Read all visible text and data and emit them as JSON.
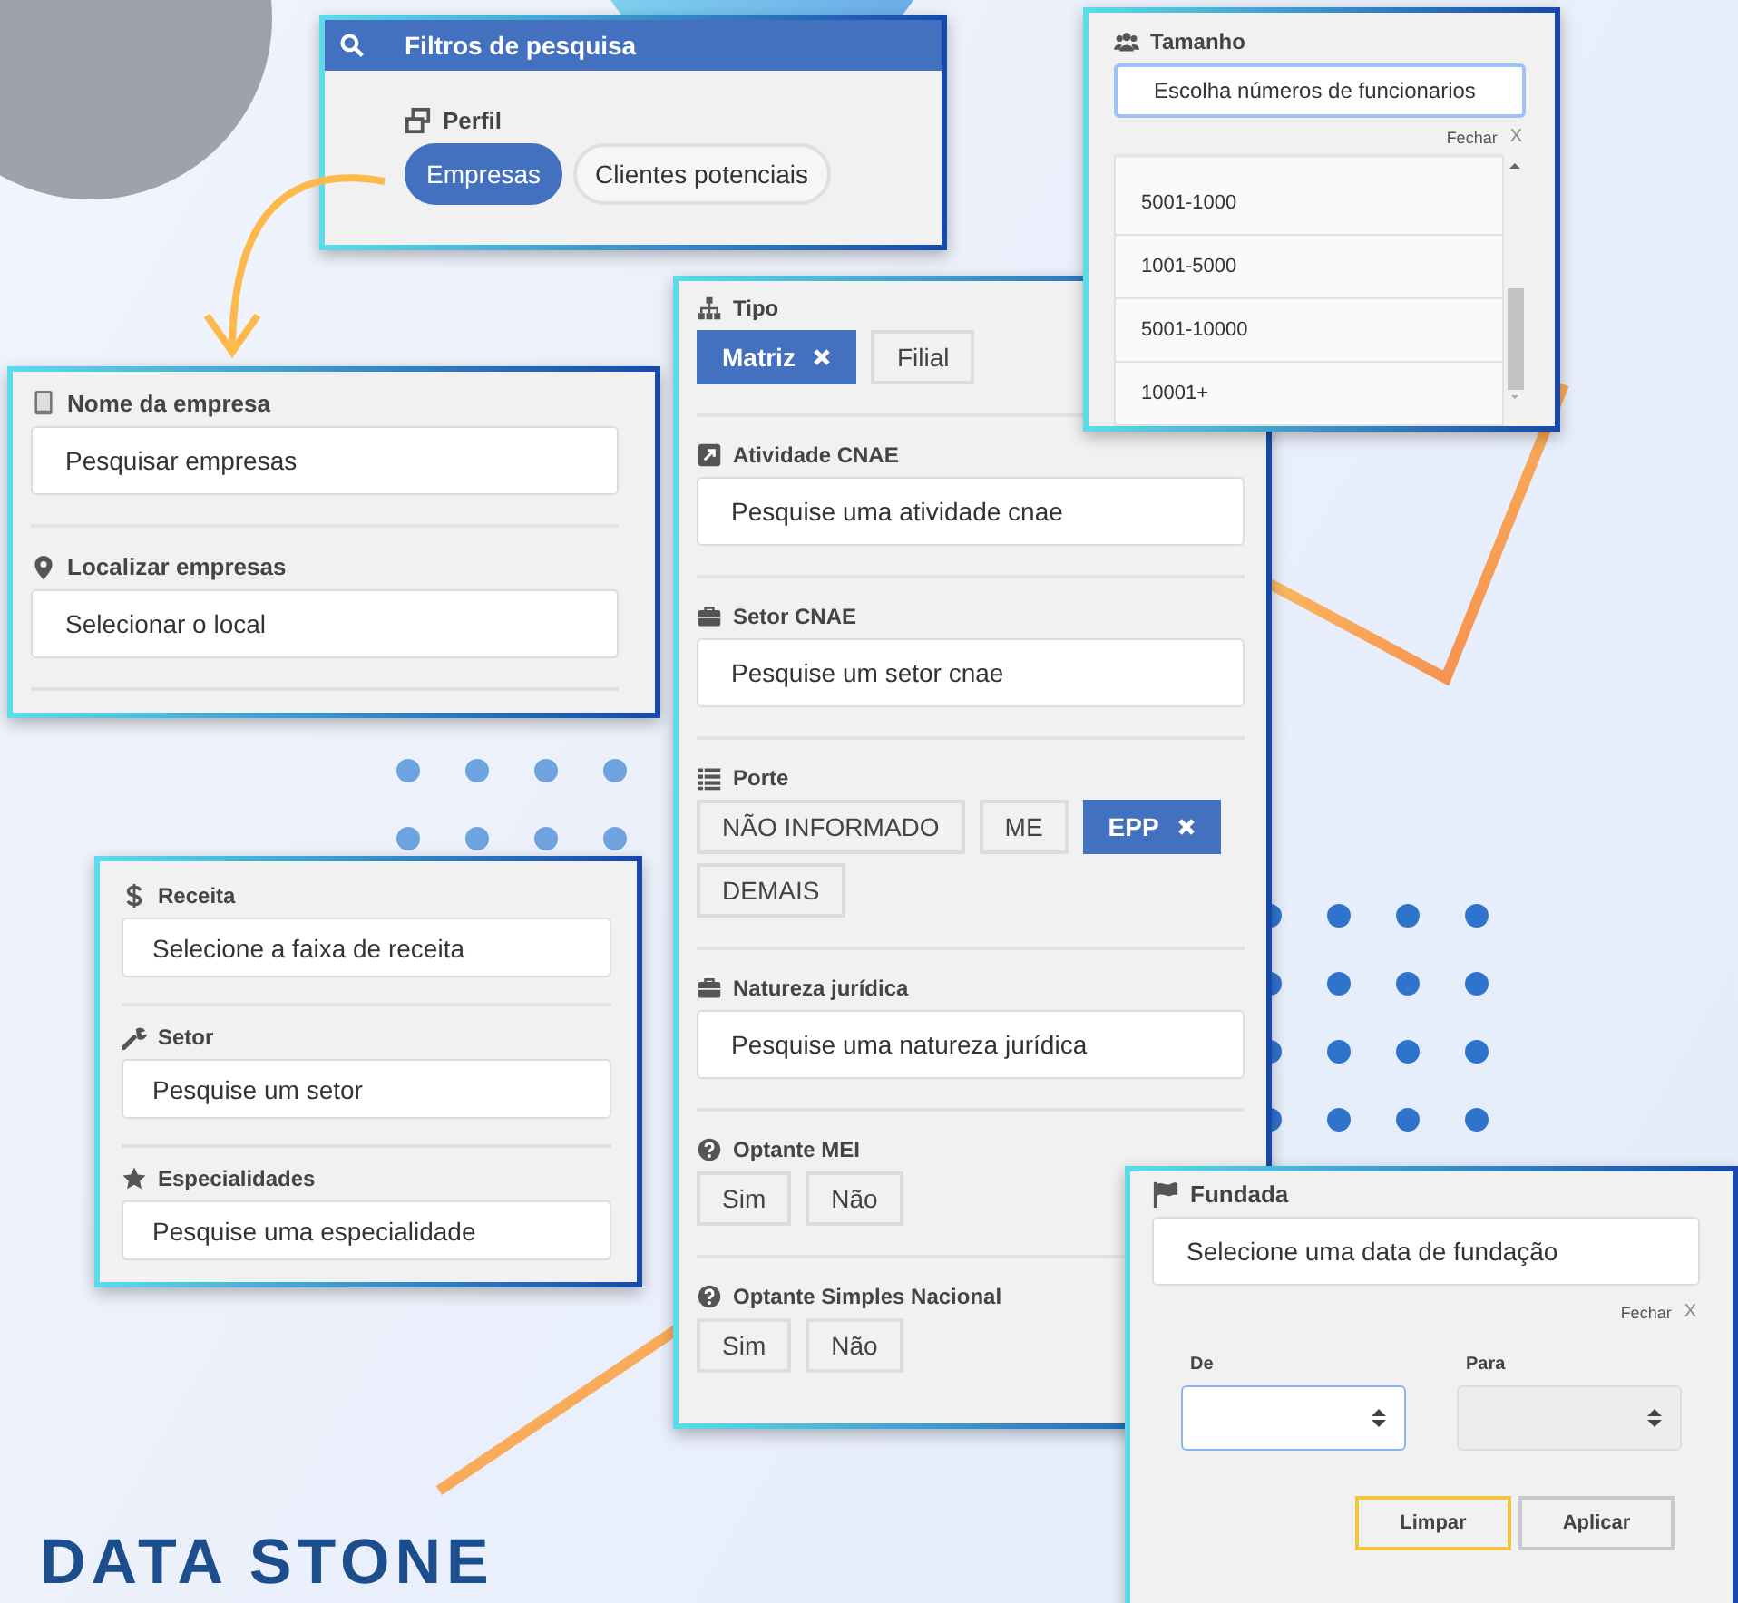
{
  "search_panel": {
    "title": "Filtros de pesquisa",
    "section": "Perfil",
    "options": [
      {
        "label": "Empresas",
        "selected": true
      },
      {
        "label": "Clientes potenciais",
        "selected": false
      }
    ]
  },
  "company_panel": {
    "fields": [
      {
        "label": "Nome da empresa",
        "placeholder": "Pesquisar empresas"
      },
      {
        "label": "Localizar empresas",
        "placeholder": "Selecionar o local"
      }
    ]
  },
  "profile_panel": {
    "fields": [
      {
        "label": "Receita",
        "placeholder": "Selecione a faixa de receita"
      },
      {
        "label": "Setor",
        "placeholder": "Pesquise um setor"
      },
      {
        "label": "Especialidades",
        "placeholder": "Pesquise uma especialidade"
      }
    ]
  },
  "filters_panel": {
    "sections": [
      {
        "kind": "chips",
        "label": "Tipo",
        "options": [
          {
            "label": "Matriz",
            "selected": true
          },
          {
            "label": "Filial",
            "selected": false
          }
        ]
      },
      {
        "kind": "search",
        "label": "Atividade CNAE",
        "placeholder": "Pesquise uma atividade cnae"
      },
      {
        "kind": "search",
        "label": "Setor CNAE",
        "placeholder": "Pesquise um setor cnae"
      },
      {
        "kind": "chips",
        "label": "Porte",
        "options": [
          {
            "label": "NÃO INFORMADO",
            "selected": false
          },
          {
            "label": "ME",
            "selected": false
          },
          {
            "label": "EPP",
            "selected": true
          },
          {
            "label": "DEMAIS",
            "selected": false
          }
        ]
      },
      {
        "kind": "search",
        "label": "Natureza jurídica",
        "placeholder": "Pesquise uma natureza jurídica"
      },
      {
        "kind": "chips",
        "label": "Optante MEI",
        "options": [
          {
            "label": "Sim",
            "selected": false
          },
          {
            "label": "Não",
            "selected": false
          }
        ]
      },
      {
        "kind": "chips",
        "label": "Optante Simples Nacional",
        "options": [
          {
            "label": "Sim",
            "selected": false
          },
          {
            "label": "Não",
            "selected": false
          }
        ]
      }
    ]
  },
  "size_panel": {
    "label": "Tamanho",
    "placeholder": "Escolha números de funcionarios",
    "focused": true,
    "close_label": "Fechar",
    "close_mark": "X",
    "options": [
      "5001-1000",
      "1001-5000",
      "5001-10000",
      "10001+"
    ]
  },
  "founded_panel": {
    "label": "Fundada",
    "placeholder": "Selecione uma data de fundação",
    "close_label": "Fechar",
    "close_mark": "X",
    "ranges": [
      {
        "label": "De",
        "focused": true,
        "disabled": false
      },
      {
        "label": "Para",
        "focused": false,
        "disabled": true
      }
    ],
    "buttons": [
      {
        "label": "Limpar",
        "focused": true
      },
      {
        "label": "Aplicar",
        "focused": false
      }
    ]
  },
  "logo": "DATA STONE"
}
